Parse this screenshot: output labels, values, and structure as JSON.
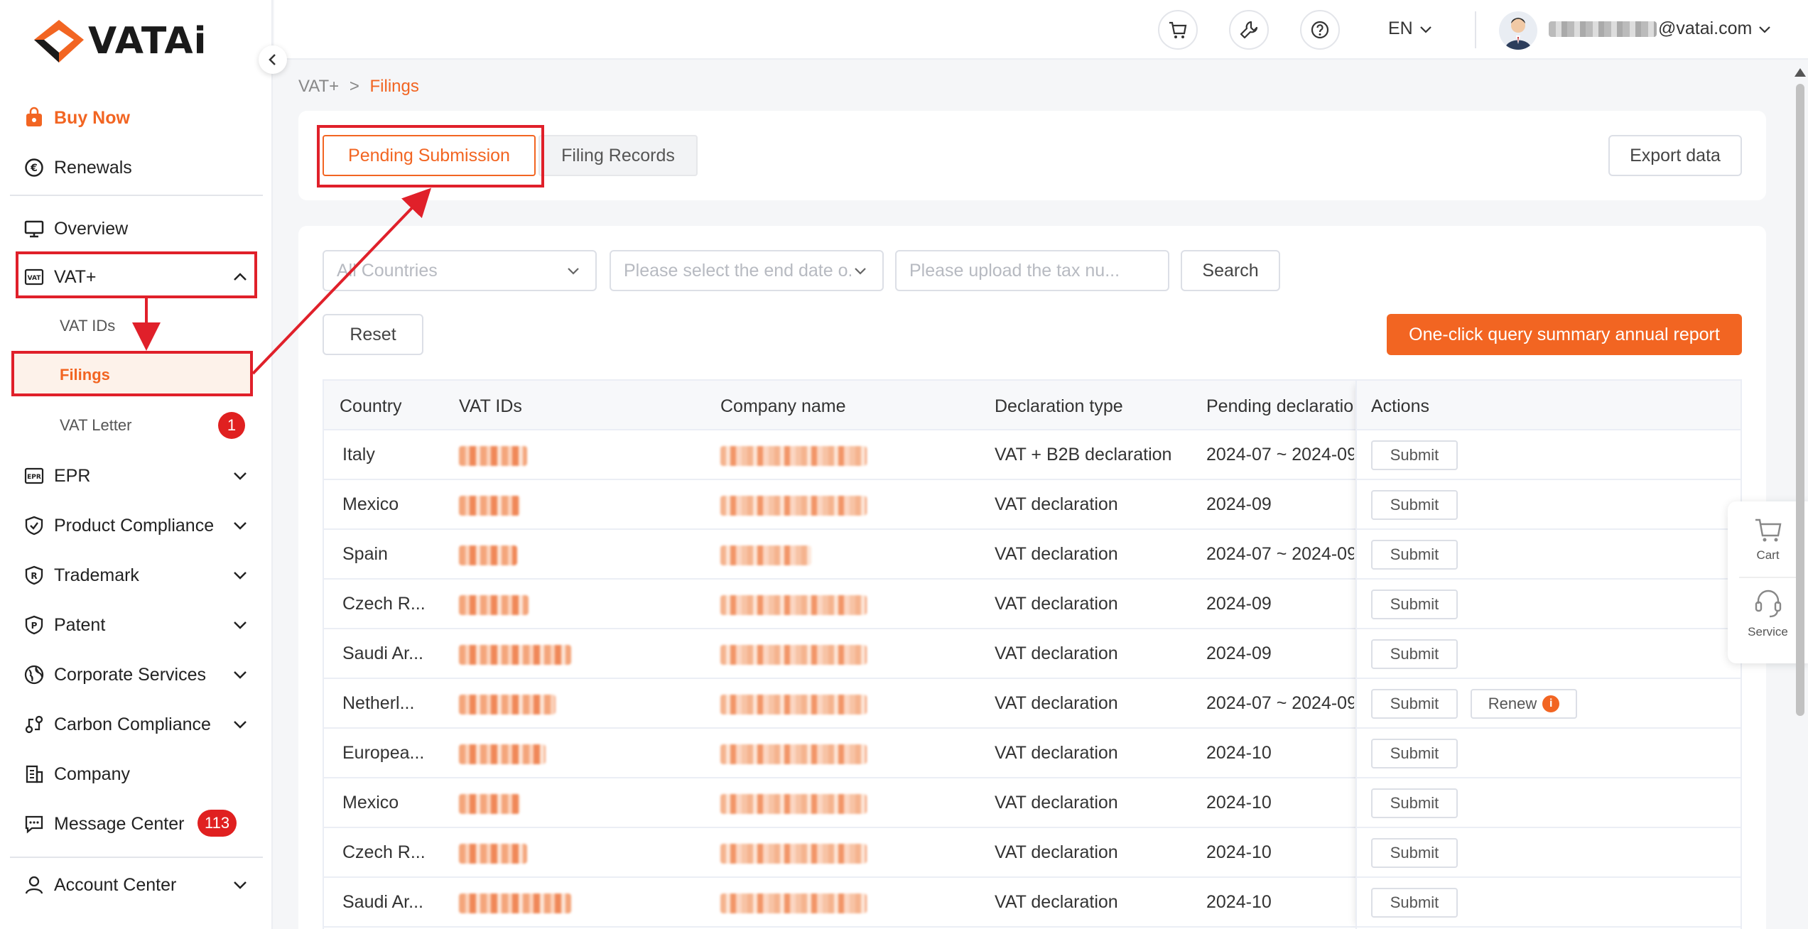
{
  "brand": {
    "name": "VATAi",
    "accent": "#f26522"
  },
  "sidebar": {
    "buy_now": "Buy Now",
    "renewals": "Renewals",
    "overview": "Overview",
    "vat_plus": "VAT+",
    "vat_ids": "VAT IDs",
    "filings": "Filings",
    "vat_letter": "VAT Letter",
    "vat_letter_badge": "1",
    "epr": "EPR",
    "product_compliance": "Product Compliance",
    "trademark": "Trademark",
    "patent": "Patent",
    "corporate_services": "Corporate Services",
    "carbon_compliance": "Carbon Compliance",
    "company": "Company",
    "message_center": "Message Center",
    "message_badge": "113",
    "account_center": "Account Center"
  },
  "topbar": {
    "lang": "EN",
    "email_suffix": "@vatai.com",
    "icons": [
      "cart-icon",
      "tools-icon",
      "help-icon"
    ]
  },
  "breadcrumb": {
    "root": "VAT+",
    "sep": ">",
    "current": "Filings"
  },
  "tabs": {
    "pending": "Pending Submission",
    "records": "Filing Records",
    "export": "Export data"
  },
  "filters": {
    "country": "All Countries",
    "date_placeholder": "Please select the end date o...",
    "tax_placeholder": "Please upload the tax nu...",
    "search": "Search",
    "reset": "Reset",
    "annual_report": "One-click query summary annual report"
  },
  "table": {
    "headers": {
      "country": "Country",
      "vat_ids": "VAT IDs",
      "company": "Company name",
      "decl_type": "Declaration type",
      "pending": "Pending declaratio",
      "actions": "Actions"
    },
    "submit_label": "Submit",
    "renew_label": "Renew",
    "rows": [
      {
        "country": "Italy",
        "type": "VAT + B2B declaration",
        "period": "2024-07 ~ 2024-09",
        "renew": false
      },
      {
        "country": "Mexico",
        "type": "VAT declaration",
        "period": "2024-09",
        "renew": false
      },
      {
        "country": "Spain",
        "type": "VAT declaration",
        "period": "2024-07 ~ 2024-09",
        "renew": false
      },
      {
        "country": "Czech R...",
        "type": "VAT declaration",
        "period": "2024-09",
        "renew": false
      },
      {
        "country": "Saudi Ar...",
        "type": "VAT declaration",
        "period": "2024-09",
        "renew": false
      },
      {
        "country": "Netherl...",
        "type": "VAT declaration",
        "period": "2024-07 ~ 2024-09",
        "renew": true
      },
      {
        "country": "Europea...",
        "type": "VAT declaration",
        "period": "2024-10",
        "renew": false
      },
      {
        "country": "Mexico",
        "type": "VAT declaration",
        "period": "2024-10",
        "renew": false
      },
      {
        "country": "Czech R...",
        "type": "VAT declaration",
        "period": "2024-10",
        "renew": false
      },
      {
        "country": "Saudi Ar...",
        "type": "VAT declaration",
        "period": "2024-10",
        "renew": false
      }
    ]
  },
  "float": {
    "cart": "Cart",
    "service": "Service"
  }
}
